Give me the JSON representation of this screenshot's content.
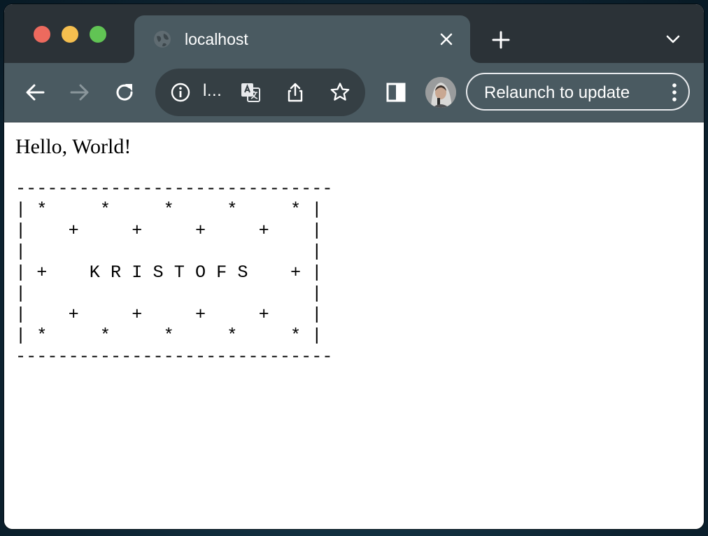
{
  "browser": {
    "tab": {
      "title": "localhost",
      "favicon": "globe-icon"
    },
    "omnibox": {
      "display_text": "l..."
    },
    "relaunch": {
      "label": "Relaunch to update"
    },
    "colors": {
      "tabstrip": "#2b3237",
      "toolbar": "#4a5a61",
      "omnibox": "#353f44",
      "close": "#ed6a5e",
      "minimize": "#f5bf4f",
      "zoom": "#61c454"
    }
  },
  "page": {
    "greeting": "Hello, World!",
    "banner_lines": [
      "------------------------------",
      "| *     *     *     *     * |",
      "|    +     +     +     +    |",
      "|                           |",
      "| +    K R I S T O F S    + |",
      "|                           |",
      "|    +     +     +     +    |",
      "| *     *     *     *     * |",
      "------------------------------"
    ]
  }
}
